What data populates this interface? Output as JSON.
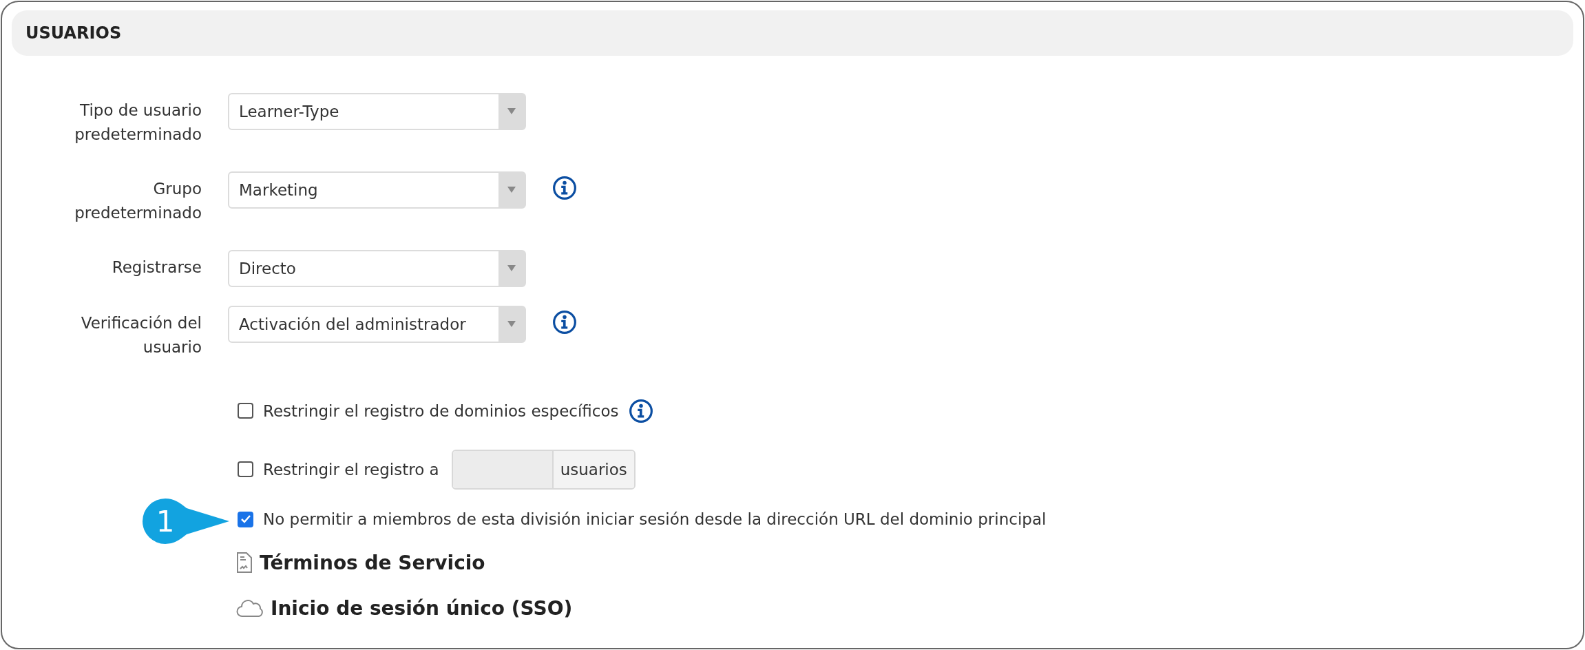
{
  "section": {
    "title": "USUARIOS"
  },
  "fields": [
    {
      "label": "Tipo de usuario predeterminado",
      "value": "Learner-Type",
      "info": false
    },
    {
      "label": "Grupo predeterminado",
      "value": "Marketing",
      "info": true
    },
    {
      "label": "Registrarse",
      "value": "Directo",
      "info": false
    },
    {
      "label": "Verificación del usuario",
      "value": "Activación del administrador",
      "info": true
    }
  ],
  "options": [
    {
      "kind": "plain",
      "label": "Restringir el registro de dominios específicos",
      "checked": false,
      "info": true
    },
    {
      "kind": "limit",
      "label": "Restringir el registro a",
      "checked": false,
      "info": false,
      "addon": "usuarios"
    },
    {
      "kind": "plain",
      "label": "No permitir a miembros de esta división iniciar sesión desde la dirección URL del dominio principal",
      "checked": true,
      "info": false,
      "callout": "1"
    }
  ],
  "links": [
    {
      "kind": "document",
      "title": "Términos de Servicio"
    },
    {
      "kind": "cloud",
      "title": "Inicio de sesión único (SSO)"
    }
  ]
}
